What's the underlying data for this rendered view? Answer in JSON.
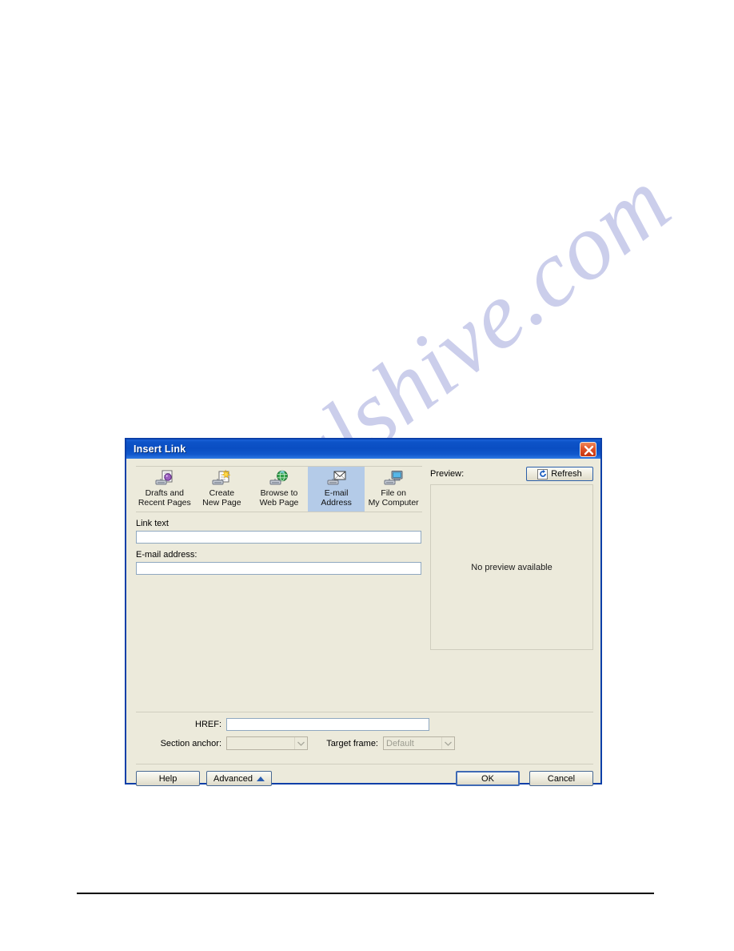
{
  "page": {
    "background_color": "#ffffff",
    "watermark_text": "manualshive.com",
    "watermark_color": "#c3c6e8",
    "footer_rule_color": "#000000"
  },
  "dialog": {
    "title": "Insert Link",
    "titlebar_color": "#0a4ec2",
    "face_color": "#eceadb",
    "border_color": "#0b3fa8",
    "close_button": {
      "name": "close-button",
      "tooltip": "Close",
      "color": "#c5330f"
    },
    "iconbar": {
      "selected_index": 3,
      "selection_color": "#b4cbe8",
      "items": [
        {
          "icon": "drafts-recent-pages-icon",
          "line1": "Drafts and",
          "line2": "Recent Pages"
        },
        {
          "icon": "create-new-page-icon",
          "line1": "Create",
          "line2": "New Page"
        },
        {
          "icon": "browse-to-web-page-icon",
          "line1": "Browse to",
          "line2": "Web Page"
        },
        {
          "icon": "email-address-icon",
          "line1": "E-mail",
          "line2": "Address"
        },
        {
          "icon": "file-on-my-computer-icon",
          "line1": "File on",
          "line2": "My Computer"
        }
      ]
    },
    "fields": {
      "link_text_label": "Link text",
      "link_text_value": "",
      "link_text_placeholder": "",
      "email_label": "E-mail address:",
      "email_value": "",
      "email_placeholder": ""
    },
    "preview": {
      "label": "Preview:",
      "refresh_label": "Refresh",
      "refresh_icon": "refresh-icon",
      "empty_message": "No preview available"
    },
    "advanced": {
      "href_label": "HREF:",
      "href_value": "",
      "section_anchor_label": "Section anchor:",
      "section_anchor_value": "",
      "section_anchor_disabled": true,
      "target_frame_label": "Target frame:",
      "target_frame_value": "Default",
      "target_frame_disabled": true
    },
    "buttons": {
      "help": "Help",
      "advanced": "Advanced",
      "advanced_glyph": "triangle-up-icon",
      "ok": "OK",
      "cancel": "Cancel"
    }
  }
}
